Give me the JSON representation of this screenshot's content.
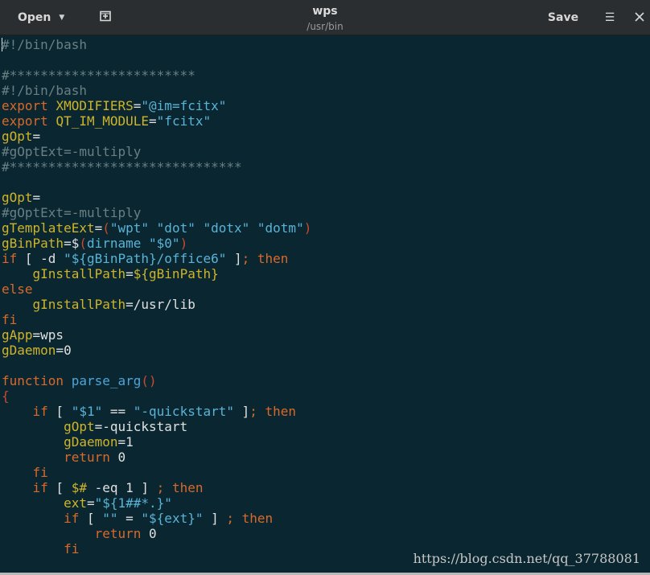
{
  "titlebar": {
    "open_label": "Open",
    "open_chevron_icon": "chevron-down-icon",
    "new_document_icon": "new-document-icon",
    "title": "wps",
    "subtitle": "/usr/bin",
    "save_label": "Save",
    "menu_icon": "hamburger-menu-icon",
    "menu_glyph": "☰",
    "close_icon": "close-icon"
  },
  "editor": {
    "lines": [
      [
        [
          "#!/bin/bash",
          "c"
        ]
      ],
      [],
      [
        [
          "#************************",
          "c"
        ]
      ],
      [
        [
          "#!/bin/bash",
          "c"
        ]
      ],
      [
        [
          "export ",
          "k"
        ],
        [
          "XMODIFIERS",
          "v"
        ],
        [
          "=",
          "p"
        ],
        [
          "\"@im=fcitx\"",
          "s"
        ]
      ],
      [
        [
          "export ",
          "k"
        ],
        [
          "QT_IM_MODULE",
          "v"
        ],
        [
          "=",
          "p"
        ],
        [
          "\"fcitx\"",
          "s"
        ]
      ],
      [
        [
          "gOpt",
          "v"
        ],
        [
          "=",
          "p"
        ]
      ],
      [
        [
          "#gOptExt=-multiply",
          "c"
        ]
      ],
      [
        [
          "#******************************",
          "c"
        ]
      ],
      [],
      [
        [
          "gOpt",
          "v"
        ],
        [
          "=",
          "p"
        ]
      ],
      [
        [
          "#gOptExt=-multiply",
          "c"
        ]
      ],
      [
        [
          "gTemplateExt",
          "v"
        ],
        [
          "=",
          "p"
        ],
        [
          "(",
          "o"
        ],
        [
          "\"wpt\" \"dot\" \"dotx\" \"dotm\"",
          "s"
        ],
        [
          ")",
          "o"
        ]
      ],
      [
        [
          "gBinPath",
          "v"
        ],
        [
          "=$",
          "p"
        ],
        [
          "(",
          "o"
        ],
        [
          "dirname ",
          "s"
        ],
        [
          "\"$0\"",
          "s"
        ],
        [
          ")",
          "o"
        ]
      ],
      [
        [
          "if",
          "k"
        ],
        [
          " [ -d ",
          "p"
        ],
        [
          "\"${gBinPath}/office6\"",
          "s"
        ],
        [
          " ]",
          "p"
        ],
        [
          "; then",
          "k"
        ]
      ],
      [
        [
          "    ",
          "p"
        ],
        [
          "gInstallPath",
          "v"
        ],
        [
          "=",
          "p"
        ],
        [
          "${gBinPath}",
          "v"
        ]
      ],
      [
        [
          "else",
          "k"
        ]
      ],
      [
        [
          "    ",
          "p"
        ],
        [
          "gInstallPath",
          "v"
        ],
        [
          "=",
          "p"
        ],
        [
          "/usr/lib",
          "p"
        ]
      ],
      [
        [
          "fi",
          "k"
        ]
      ],
      [
        [
          "gApp",
          "v"
        ],
        [
          "=wps",
          "p"
        ]
      ],
      [
        [
          "gDaemon",
          "v"
        ],
        [
          "=0",
          "p"
        ]
      ],
      [],
      [
        [
          "function ",
          "k"
        ],
        [
          "parse_arg",
          "f"
        ],
        [
          "()",
          "o"
        ]
      ],
      [
        [
          "{",
          "o"
        ]
      ],
      [
        [
          "    ",
          "p"
        ],
        [
          "if",
          "k"
        ],
        [
          " [ ",
          "p"
        ],
        [
          "\"$1\"",
          "s"
        ],
        [
          " == ",
          "p"
        ],
        [
          "\"-quickstart\"",
          "s"
        ],
        [
          " ]",
          "p"
        ],
        [
          "; then",
          "k"
        ]
      ],
      [
        [
          "        ",
          "p"
        ],
        [
          "gOpt",
          "v"
        ],
        [
          "=-quickstart",
          "p"
        ]
      ],
      [
        [
          "        ",
          "p"
        ],
        [
          "gDaemon",
          "v"
        ],
        [
          "=1",
          "p"
        ]
      ],
      [
        [
          "        ",
          "p"
        ],
        [
          "return",
          "k"
        ],
        [
          " 0",
          "p"
        ]
      ],
      [
        [
          "    ",
          "p"
        ],
        [
          "fi",
          "k"
        ]
      ],
      [
        [
          "    ",
          "p"
        ],
        [
          "if",
          "k"
        ],
        [
          " [ ",
          "p"
        ],
        [
          "$#",
          "v"
        ],
        [
          " -eq 1 ] ",
          "p"
        ],
        [
          "; then",
          "k"
        ]
      ],
      [
        [
          "        ",
          "p"
        ],
        [
          "ext",
          "v"
        ],
        [
          "=",
          "p"
        ],
        [
          "\"${1##*.}\"",
          "s"
        ]
      ],
      [
        [
          "        ",
          "p"
        ],
        [
          "if",
          "k"
        ],
        [
          " [ ",
          "p"
        ],
        [
          "\"\"",
          "s"
        ],
        [
          " = ",
          "p"
        ],
        [
          "\"${ext}\"",
          "s"
        ],
        [
          " ] ",
          "p"
        ],
        [
          "; then",
          "k"
        ]
      ],
      [
        [
          "            ",
          "p"
        ],
        [
          "return",
          "k"
        ],
        [
          " 0",
          "p"
        ]
      ],
      [
        [
          "        ",
          "p"
        ],
        [
          "fi",
          "k"
        ]
      ]
    ]
  },
  "watermark": "https://blog.csdn.net/qq_37788081"
}
